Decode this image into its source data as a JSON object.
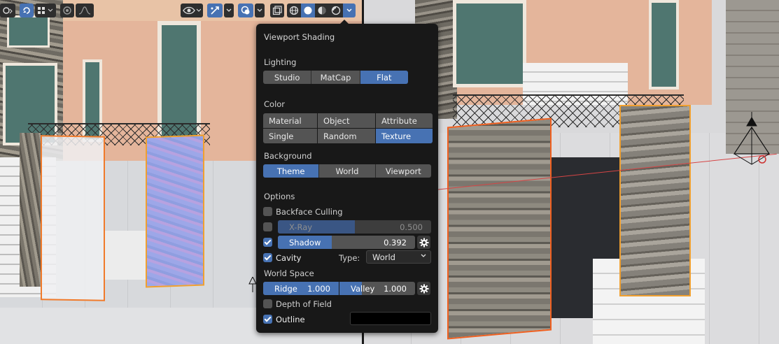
{
  "panel": {
    "title": "Viewport Shading",
    "lighting": {
      "label": "Lighting",
      "options": [
        "Studio",
        "MatCap",
        "Flat"
      ],
      "selected": "Flat"
    },
    "color": {
      "label": "Color",
      "options": [
        "Material",
        "Object",
        "Attribute",
        "Single",
        "Random",
        "Texture"
      ],
      "selected": "Texture"
    },
    "background": {
      "label": "Background",
      "options": [
        "Theme",
        "World",
        "Viewport"
      ],
      "selected": "Theme"
    },
    "options": {
      "label": "Options",
      "backface_culling": {
        "label": "Backface Culling",
        "checked": false
      },
      "xray": {
        "label": "X-Ray",
        "value": "0.500",
        "checked": false,
        "fill": 0.5
      },
      "shadow": {
        "label": "Shadow",
        "value": "0.392",
        "checked": true,
        "fill": 0.392
      },
      "cavity": {
        "label": "Cavity",
        "checked": true,
        "type_label": "Type:",
        "type_value": "World"
      },
      "world_space": {
        "label": "World Space"
      },
      "ridge": {
        "label": "Ridge",
        "value": "1.000"
      },
      "valley": {
        "label": "Valley",
        "value": "1.000"
      },
      "depth_of_field": {
        "label": "Depth of Field",
        "checked": false
      },
      "outline": {
        "label": "Outline",
        "checked": true,
        "color": "#000000"
      }
    }
  },
  "header": {
    "icons": [
      "editor-type-icon",
      "overlay-toggle-icon",
      "snap-grid-icon",
      "proportional-edit-icon",
      "falloff-icon",
      "visibility-icon",
      "gizmo-icon",
      "overlays-icon",
      "xray-toggle-icon",
      "wireframe-shading-icon",
      "solid-shading-icon",
      "material-preview-icon",
      "rendered-shading-icon",
      "shading-dropdown-icon"
    ]
  },
  "colors": {
    "accent": "#4772b3",
    "panel_bg": "#181818",
    "button_bg": "#545454",
    "selection_orange": "#f07a2a"
  }
}
